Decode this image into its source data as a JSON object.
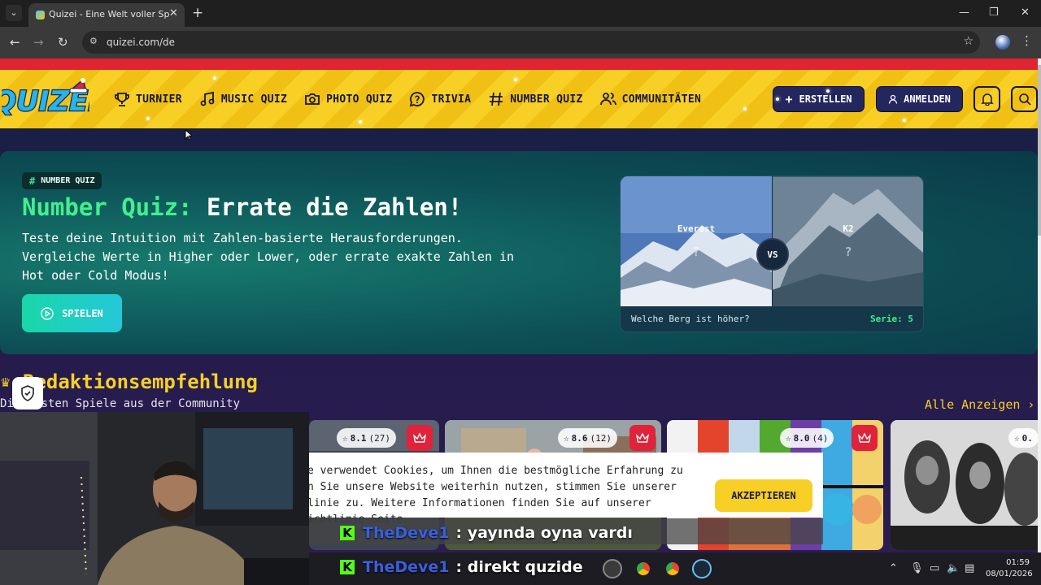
{
  "browser": {
    "tab_title": "Quizei - Eine Welt voller Spaß u",
    "url": "quizei.com/de",
    "icons": [
      "tab-list-icon",
      "close-icon",
      "plus-icon",
      "minimize-icon",
      "maximize-icon",
      "back-icon",
      "forward-icon",
      "reload-icon",
      "site-info-icon",
      "star-icon",
      "profile-icon",
      "kebab-icon"
    ]
  },
  "header": {
    "logo_text": "QUIZEI",
    "nav": [
      {
        "label": "TURNIER",
        "icon": "trophy-icon"
      },
      {
        "label": "MUSIC QUIZ",
        "icon": "music-icon"
      },
      {
        "label": "PHOTO QUIZ",
        "icon": "camera-icon"
      },
      {
        "label": "TRIVIA",
        "icon": "chat-question-icon"
      },
      {
        "label": "NUMBER QUIZ",
        "icon": "hash-icon"
      },
      {
        "label": "COMMUNITÄTEN",
        "icon": "users-icon"
      }
    ],
    "create_label": "ERSTELLEN",
    "login_label": "ANMELDEN",
    "colors": {
      "stripe": "#f7cf25",
      "red": "#e02431",
      "navy": "#24265e"
    }
  },
  "hero": {
    "badge": "NUMBER QUIZ",
    "title_accent": "Number Quiz:",
    "title_main": "Errate die Zahlen!",
    "description": "Teste deine Intuition mit Zahlen-basierte Herausforderungen. Vergleiche Werte in Higher oder Lower, oder errate exakte Zahlen in Hot oder Cold Modus!",
    "play_label": "SPIELEN",
    "preview": {
      "left_name": "Everest",
      "right_name": "K2",
      "unknown": "?",
      "vs": "VS",
      "question": "Welche Berg ist höher?",
      "serie": "Serie: 5"
    },
    "colors": {
      "accent": "#41f08f",
      "button": "#19d6a9"
    }
  },
  "recommendations": {
    "title": "Redaktionsempfehlung",
    "subtitle": "Die besten Spiele aus der Community",
    "see_all": "Alle Anzeigen ›",
    "cards": [
      {
        "rating": "8.1",
        "count": "(27)"
      },
      {
        "rating": "8.6",
        "count": "(12)"
      },
      {
        "rating": "8.0",
        "count": "(4)"
      },
      {
        "rating": "0.",
        "count": ""
      }
    ]
  },
  "cookie": {
    "text": "e verwendet Cookies, um Ihnen die bestmögliche Erfahrung zu\nn Sie unsere Website weiterhin nutzen, stimmen Sie unserer\nlinie zu. Weitere Informationen finden Sie auf unserer\nichtlinie-Seite.",
    "accept_label": "AKZEPTIEREN"
  },
  "stream_chat": [
    {
      "user": "TheDeve1",
      "message": ": yayında oyna vardı"
    },
    {
      "user": "TheDeve1",
      "message": ": direkt quzide"
    }
  ],
  "taskbar": {
    "time": "01:59",
    "date": "08/01/2026"
  }
}
